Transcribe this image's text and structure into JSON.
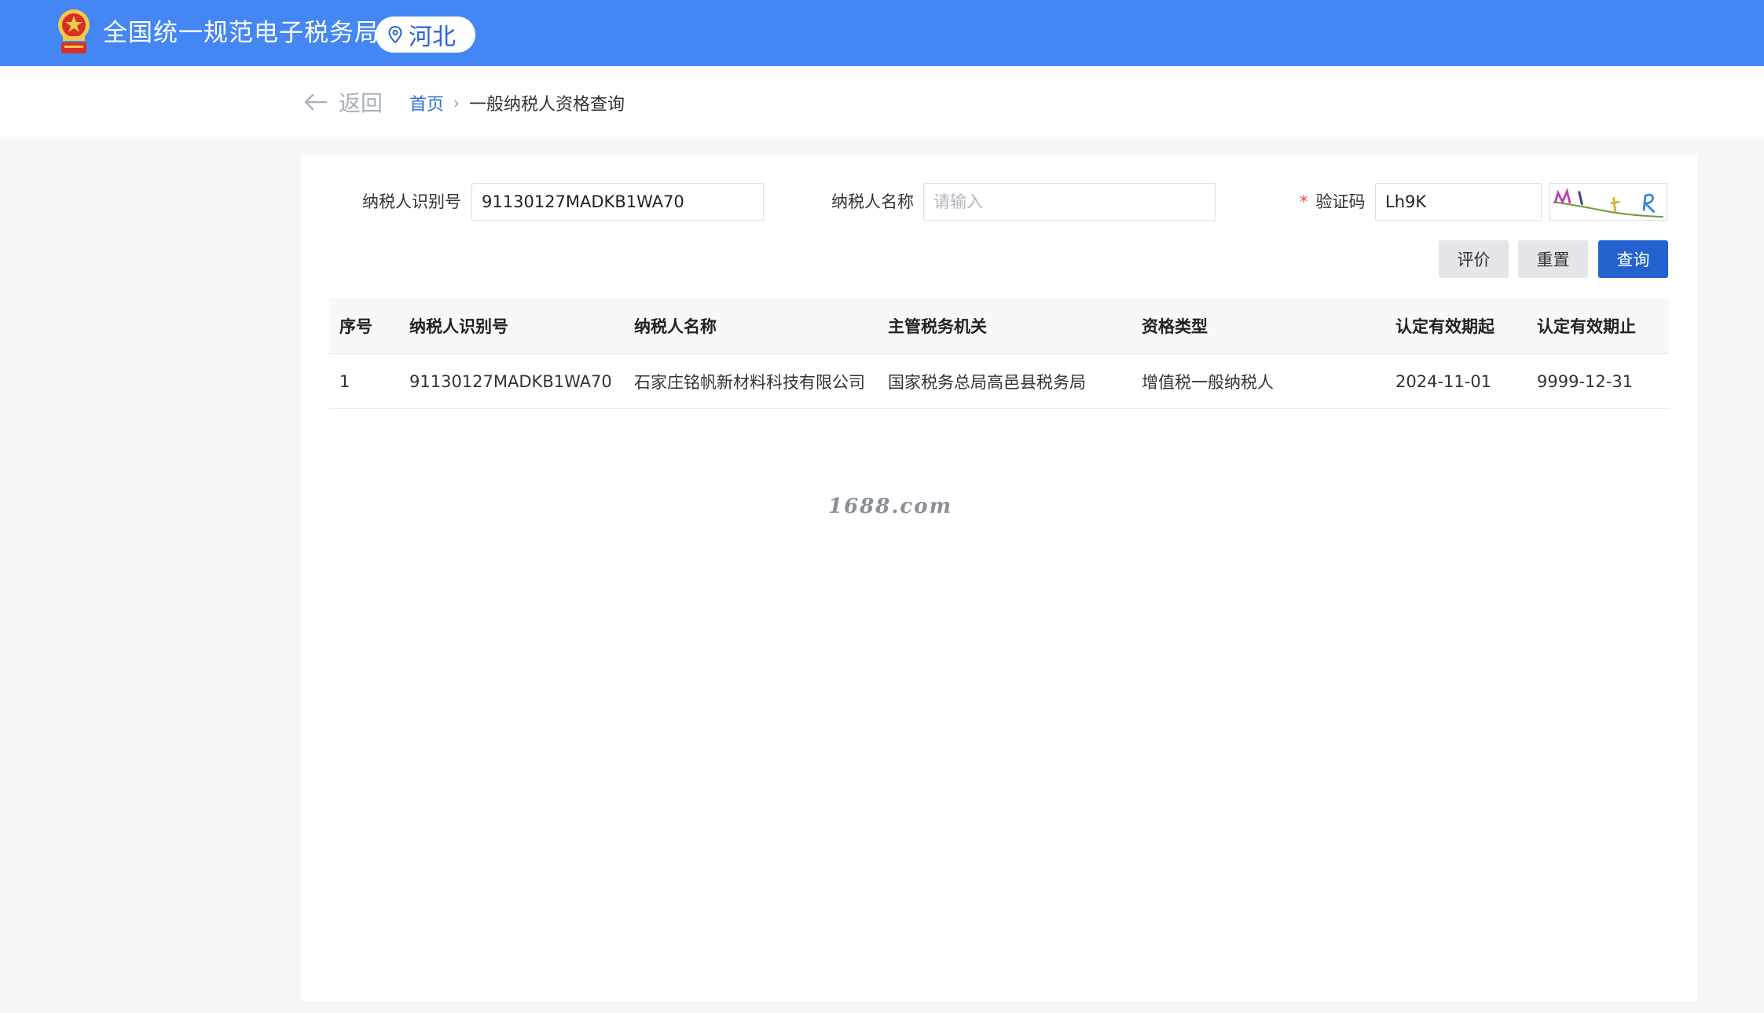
{
  "header": {
    "site_title": "全国统一规范电子税务局",
    "region": "河北"
  },
  "breadcrumb": {
    "back_label": "返回",
    "home_label": "首页",
    "current_label": "一般纳税人资格查询"
  },
  "form": {
    "taxpayer_id_label": "纳税人识别号",
    "taxpayer_id_value": "91130127MADKB1WA70",
    "taxpayer_name_label": "纳税人名称",
    "taxpayer_name_placeholder": "请输入",
    "captcha_required_mark": "*",
    "captcha_label": "验证码",
    "captcha_value": "Lh9K"
  },
  "buttons": {
    "evaluate": "评价",
    "reset": "重置",
    "search": "查询"
  },
  "table": {
    "headers": [
      "序号",
      "纳税人识别号",
      "纳税人名称",
      "主管税务机关",
      "资格类型",
      "认定有效期起",
      "认定有效期止"
    ],
    "rows": [
      [
        "1",
        "91130127MADKB1WA70",
        "石家庄铭帆新材料科技有限公司",
        "国家税务总局高邑县税务局",
        "增值税一般纳税人",
        "2024-11-01",
        "9999-12-31"
      ]
    ]
  },
  "watermark": "1688.com",
  "colors": {
    "header_bg": "#4487f4",
    "primary_button": "#2462cf",
    "link": "#2f6fd6"
  }
}
